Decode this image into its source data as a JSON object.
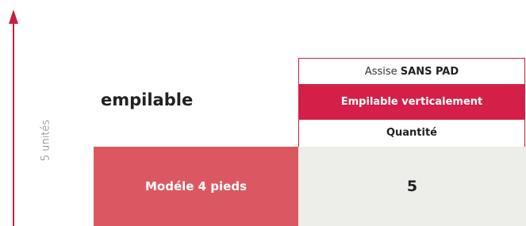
{
  "axis": {
    "label": "5 unités"
  },
  "row_title": "empilable",
  "header": {
    "assise_prefix": "Assise",
    "assise_bold": "SANS PAD",
    "empilable": "Empilable verticalement",
    "quantite": "Quantité"
  },
  "row": {
    "model": "Modéle 4 pieds",
    "value": "5"
  },
  "colors": {
    "accent": "#d41f48",
    "model_bg": "#db5862",
    "value_bg": "#ededea"
  }
}
